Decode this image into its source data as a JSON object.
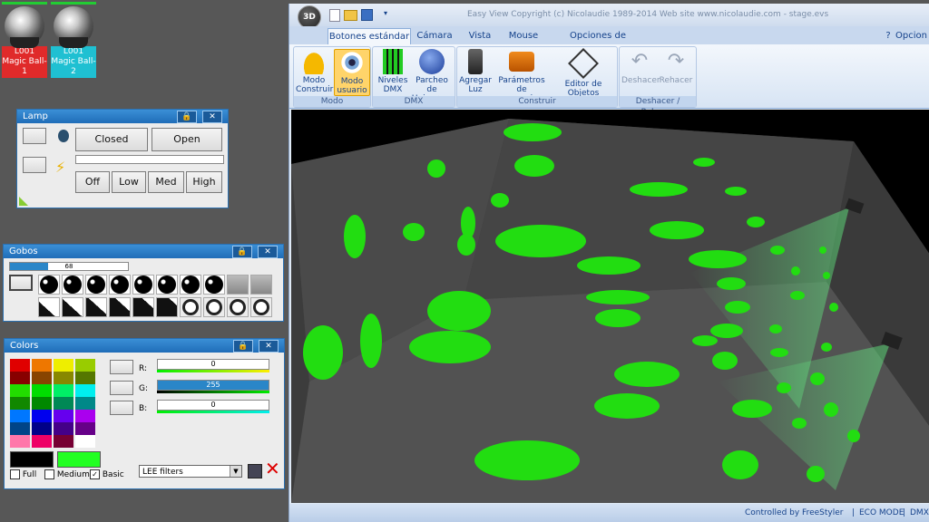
{
  "fixtures": [
    {
      "label": "L001 Magic Ball-1",
      "color": "#e02a2a"
    },
    {
      "label": "L001 Magic Ball-2",
      "color": "#1fc0d2"
    }
  ],
  "lamp": {
    "title": "Lamp",
    "buttons": {
      "closed": "Closed",
      "open": "Open",
      "off": "Off",
      "low": "Low",
      "med": "Med",
      "high": "High"
    }
  },
  "gobos": {
    "title": "Gobos",
    "value": "68",
    "fraction": 0.32
  },
  "colors": {
    "title": "Colors",
    "palette": [
      [
        "#e00000",
        "#ee7700",
        "#eeee00",
        "#99cc00"
      ],
      [
        "#880000",
        "#884400",
        "#888800",
        "#557700"
      ],
      [
        "#22dd00",
        "#00dd00",
        "#00ee66",
        "#00eeee"
      ],
      [
        "#118800",
        "#008800",
        "#008855",
        "#008888"
      ],
      [
        "#0077ff",
        "#0000ee",
        "#6600ee",
        "#aa00ee"
      ],
      [
        "#004488",
        "#000088",
        "#440088",
        "#660088"
      ],
      [
        "#ff77aa",
        "#ee0066",
        "#770033",
        "#ffffff"
      ]
    ],
    "current_a": "#000000",
    "current_b": "#22ff22",
    "r_label": "R:",
    "r_value": "0",
    "g_label": "G:",
    "g_value": "255",
    "b_label": "B:",
    "b_value": "0",
    "full_label": "Full",
    "medium_label": "Medium",
    "basic_label": "Basic",
    "filter_select": "LEE filters"
  },
  "app": {
    "title": "Easy View   Copyright (c) Nicolaudie 1989-2014   Web site www.nicolaudie.com - stage.evs",
    "logo": "3D",
    "help": "?",
    "tabs": [
      "Botones estándar",
      "Cámara",
      "Vista",
      "Mouse",
      "Opciones de recursos"
    ],
    "options": "Opcion",
    "groups": {
      "modo": "Modo",
      "dmx": "DMX",
      "construir": "Construir",
      "undo": "Deshacer / Rehacer"
    },
    "buttons": {
      "modo_construir": "Modo Construir",
      "modo_usuario": "Modo usuario",
      "niveles": "Niveles DMX",
      "parcheo": "Parcheo de Universos",
      "agregar": "Agregar Luz",
      "parametros": "Parámetros de escenario...",
      "editor": "Editor de Objetos simples",
      "deshacer": "Deshacer",
      "rehacer": "Rehacer"
    },
    "status": {
      "controlled": "Controlled by FreeStyler",
      "eco": "ECO MODE",
      "dmx": "DMX"
    }
  },
  "accent": "#33dd22"
}
